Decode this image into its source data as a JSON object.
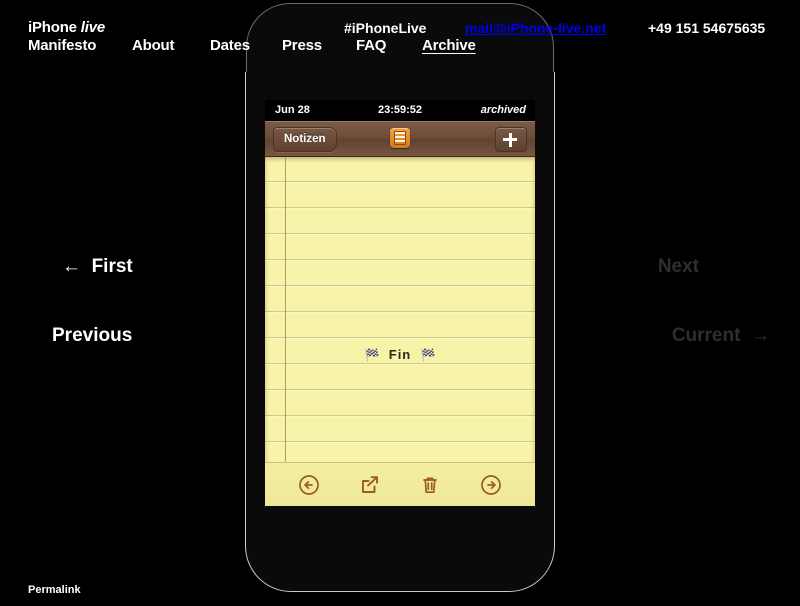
{
  "header": {
    "brand_main": "iPhone ",
    "brand_italic": "live",
    "hashtag": "#iPhoneLive",
    "email": "mail@iPhone-live.net",
    "phone": "+49 151 54675635",
    "nav": [
      {
        "label": "Manifesto",
        "active": false
      },
      {
        "label": "About",
        "active": false
      },
      {
        "label": "Dates",
        "active": false
      },
      {
        "label": "Press",
        "active": false
      },
      {
        "label": "FAQ",
        "active": false
      },
      {
        "label": "Archive",
        "active": true
      }
    ]
  },
  "phone": {
    "status_bar": {
      "date": "Jun 28",
      "time": "23:59:52",
      "state": "archived"
    },
    "navbar": {
      "back_label": "Notizen",
      "app_icon": "notes-app-icon",
      "add_label": "+"
    },
    "note": {
      "text": "Fin",
      "flag_left": "🏁",
      "flag_right": "🏁"
    },
    "toolbar": [
      {
        "name": "previous-note-icon",
        "label": "Previous note"
      },
      {
        "name": "share-icon",
        "label": "Share"
      },
      {
        "name": "trash-icon",
        "label": "Delete"
      },
      {
        "name": "next-note-icon",
        "label": "Next note"
      }
    ]
  },
  "side_nav": {
    "first": {
      "label": "First",
      "arrow": "←",
      "enabled": true
    },
    "previous": {
      "label": "Previous",
      "enabled": true
    },
    "next": {
      "label": "Next",
      "enabled": false
    },
    "current": {
      "label": "Current",
      "arrow": "→",
      "enabled": false
    }
  },
  "footer": {
    "permalink": "Permalink"
  },
  "colors": {
    "background": "#000000",
    "paper": "#f7f3a8",
    "navbar_brown": "#6d4c38",
    "accent_orange": "#d4791e",
    "toolbar_icon": "#9c5a25",
    "disabled_text": "#2e2e2e"
  }
}
